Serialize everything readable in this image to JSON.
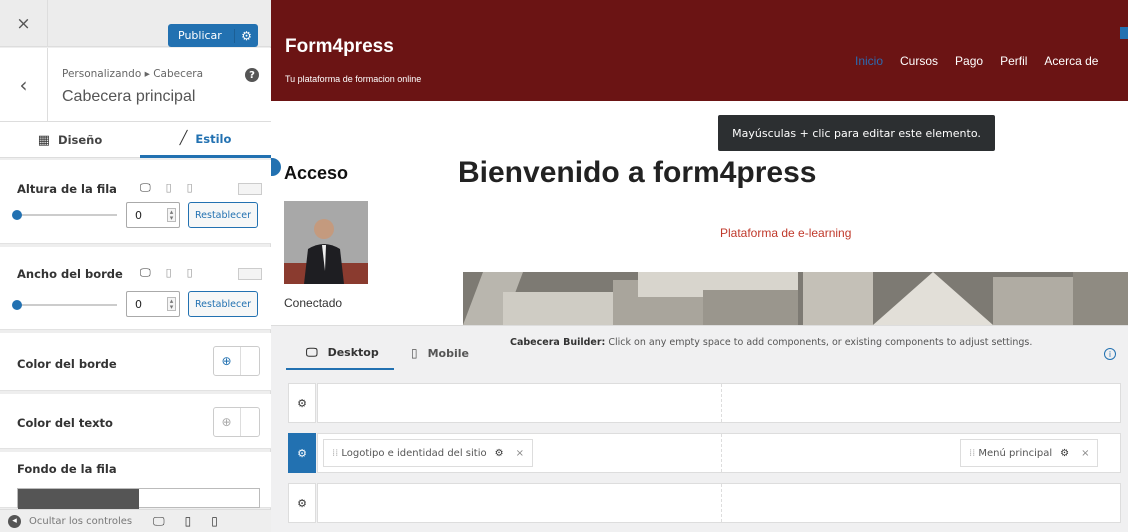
{
  "panel": {
    "close_icon": "×",
    "publish_label": "Publicar",
    "back_icon": "‹",
    "crumb": "Personalizando ▸ Cabecera",
    "title": "Cabecera principal",
    "tabs": [
      {
        "label": "Diseño",
        "icon": "grid-icon"
      },
      {
        "label": "Estilo",
        "icon": "brush-icon",
        "active": true
      }
    ],
    "row_height": {
      "label": "Altura de la fila",
      "value": "0",
      "reset": "Restablecer"
    },
    "border_width": {
      "label": "Ancho del borde",
      "value": "0",
      "reset": "Restablecer"
    },
    "border_color": {
      "label": "Color del borde"
    },
    "text_color": {
      "label": "Color del texto"
    },
    "row_bg": {
      "label": "Fondo de la fila"
    },
    "hide_controls": "Ocultar los controles"
  },
  "site": {
    "title": "Form4press",
    "tagline": "Tu plataforma de formacion online",
    "nav": [
      "Inicio",
      "Cursos",
      "Pago",
      "Perfil",
      "Acerca de"
    ],
    "nav_active": "Inicio",
    "tooltip": "Mayúsculas + clic para editar este elemento.",
    "access_title": "Acceso",
    "connected": "Conectado",
    "welcome": "Bienvenido a form4press",
    "subtitle": "Plataforma de e-learning",
    "header_color": "#6b1414"
  },
  "builder": {
    "tab_desktop": "Desktop",
    "tab_mobile": "Mobile",
    "msg_bold": "Cabecera Builder:",
    "msg": "Click on any empty space to add components, or existing components to adjust settings.",
    "info_icon": "i",
    "chip_logo": "Logotipo e identidad del sitio",
    "chip_menu": "Menú principal",
    "accent": "#2271b1"
  }
}
